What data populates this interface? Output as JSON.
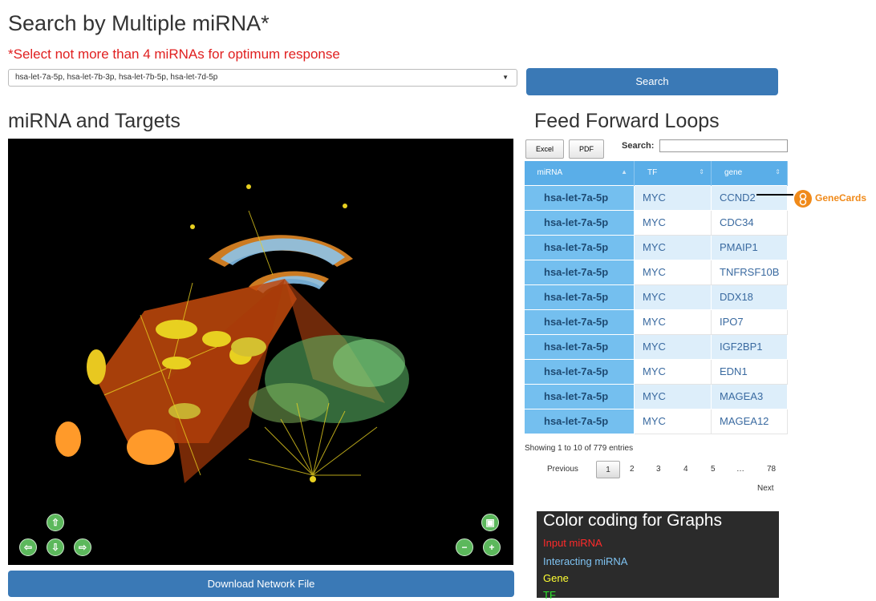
{
  "header": {
    "title": "Search by Multiple miRNA*",
    "warning": "*Select not more than 4 miRNAs for optimum response",
    "select_value": "hsa-let-7a-5p, hsa-let-7b-3p, hsa-let-7b-5p, hsa-let-7d-5p",
    "search_label": "Search"
  },
  "network": {
    "title": "miRNA and Targets",
    "download_label": "Download Network File"
  },
  "ffl": {
    "title": "Feed Forward Loops",
    "excel_label": "Excel",
    "pdf_label": "PDF",
    "search_label": "Search:",
    "search_value": "",
    "columns": [
      "miRNA",
      "TF",
      "gene"
    ],
    "rows": [
      [
        "hsa-let-7a-5p",
        "MYC",
        "CCND2"
      ],
      [
        "hsa-let-7a-5p",
        "MYC",
        "CDC34"
      ],
      [
        "hsa-let-7a-5p",
        "MYC",
        "PMAIP1"
      ],
      [
        "hsa-let-7a-5p",
        "MYC",
        "TNFRSF10B"
      ],
      [
        "hsa-let-7a-5p",
        "MYC",
        "DDX18"
      ],
      [
        "hsa-let-7a-5p",
        "MYC",
        "IPO7"
      ],
      [
        "hsa-let-7a-5p",
        "MYC",
        "IGF2BP1"
      ],
      [
        "hsa-let-7a-5p",
        "MYC",
        "EDN1"
      ],
      [
        "hsa-let-7a-5p",
        "MYC",
        "MAGEA3"
      ],
      [
        "hsa-let-7a-5p",
        "MYC",
        "MAGEA12"
      ]
    ],
    "showing": "Showing 1 to 10 of 779 entries",
    "pagination": {
      "previous": "Previous",
      "pages": [
        "1",
        "2",
        "3",
        "4",
        "5",
        "…",
        "78"
      ],
      "next": "Next"
    },
    "genecards_label": "GeneCards"
  },
  "legend": {
    "title": "Color coding for Graphs",
    "items": [
      {
        "label": "Input miRNA",
        "color": "#ff2a2a"
      },
      {
        "label": "Interacting miRNA",
        "color": "#7fc3f2"
      },
      {
        "label": "Gene",
        "color": "#ffff33"
      },
      {
        "label": "TF",
        "color": "#2ee82e"
      }
    ]
  },
  "colors": {
    "primary_button": "#3a79b6",
    "warning": "#e02020",
    "table_header": "#5aaee8",
    "nav_button": "#5cb85c"
  }
}
